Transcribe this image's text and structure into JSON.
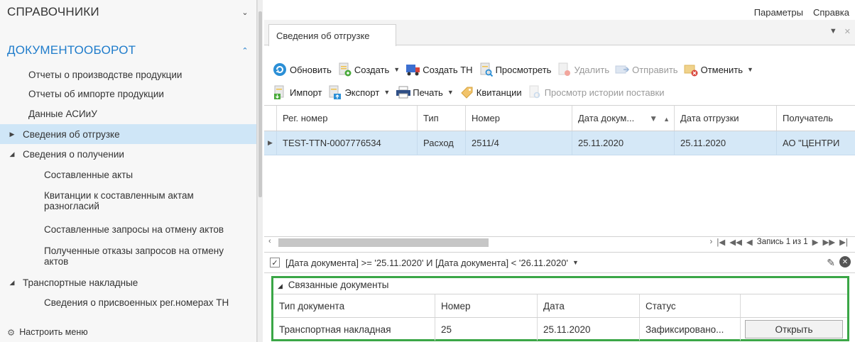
{
  "sidebar": {
    "section1_title": "СПРАВОЧНИКИ",
    "section2_title": "ДОКУМЕНТООБОРОТ",
    "items": [
      {
        "label": "Отчеты о производстве продукции"
      },
      {
        "label": "Отчеты об импорте продукции"
      },
      {
        "label": "Данные АСИиУ"
      },
      {
        "label": "Сведения об отгрузке"
      },
      {
        "label": "Сведения о получении"
      },
      {
        "label": "Составленные акты"
      },
      {
        "label": "Квитанции к составленным актам"
      },
      {
        "label": "разногласий"
      },
      {
        "label": "Составленные запросы на отмену актов"
      },
      {
        "label": "Полученные отказы запросов на отмену"
      },
      {
        "label": "актов"
      },
      {
        "label": "Транспортные накладные"
      },
      {
        "label": "Сведения о присвоенных рег.номерах ТН"
      }
    ],
    "settings_label": "Настроить меню"
  },
  "topmenu": {
    "params": "Параметры",
    "help": "Справка"
  },
  "tab": {
    "label": "Сведения об отгрузке"
  },
  "toolbar1": {
    "refresh": "Обновить",
    "create": "Создать",
    "create_tn": "Создать ТН",
    "view": "Просмотреть",
    "delete": "Удалить",
    "send": "Отправить",
    "cancel": "Отменить"
  },
  "toolbar2": {
    "import": "Импорт",
    "export": "Экспорт",
    "print": "Печать",
    "receipts": "Квитанции",
    "history": "Просмотр истории поставки"
  },
  "grid": {
    "columns": [
      "Рег. номер",
      "Тип",
      "Номер",
      "Дата докум...",
      "Дата отгрузки",
      "Получатель"
    ],
    "rows": [
      [
        "TEST-TTN-0007776534",
        "Расход",
        "2511/4",
        "25.11.2020",
        "25.11.2020",
        "АО \"ЦЕНТРИ"
      ]
    ]
  },
  "pager": {
    "label": "Запись 1 из 1"
  },
  "filter": {
    "text": "[Дата документа] >= '25.11.2020' И [Дата документа] < '26.11.2020'"
  },
  "linked": {
    "title": "Связанные документы",
    "columns": [
      "Тип документа",
      "Номер",
      "Дата",
      "Статус"
    ],
    "row": [
      "Транспортная накладная",
      "25",
      "25.11.2020",
      "Зафиксировано..."
    ],
    "open_label": "Открыть"
  },
  "colors": {
    "accent": "#1f7ccb",
    "selection": "#cfe6f7",
    "highlight_border": "#3aa646"
  }
}
